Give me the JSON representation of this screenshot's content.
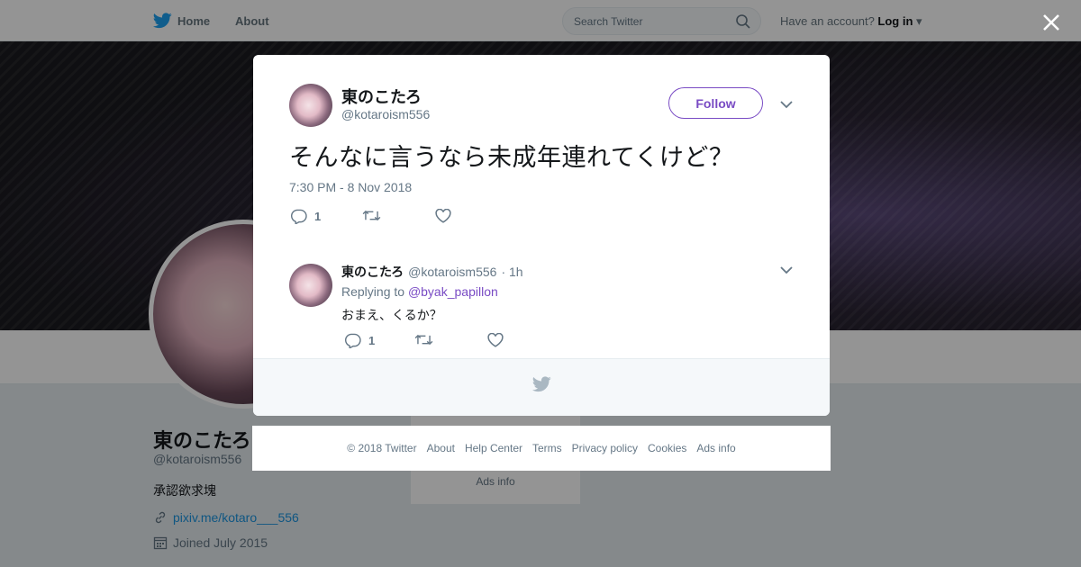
{
  "topnav": {
    "home_label": "Home",
    "about_label": "About",
    "search_placeholder": "Search Twitter",
    "have_account": "Have an account?",
    "login_label": "Log in"
  },
  "profile": {
    "name": "東のこたろ",
    "handle": "@kotaroism556",
    "bio": "承認欲求塊",
    "link": "pixiv.me/kotaro___556",
    "joined": "Joined July 2015",
    "sidecard_ads": "Ads info"
  },
  "tweet": {
    "author_name": "東のこたろ",
    "author_handle": "@kotaroism556",
    "follow_label": "Follow",
    "text": "そんなに言うなら未成年連れてくけど？",
    "timestamp": "7:30 PM - 8 Nov 2018",
    "reply_count": "1"
  },
  "reply": {
    "author_name": "東のこたろ",
    "author_handle": "@kotaroism556",
    "time": "· 1h",
    "replying_prefix": "Replying to",
    "replying_to": "@byak_papillon",
    "text": "おまえ、くるか？",
    "reply_count": "1"
  },
  "footer": {
    "copyright": "© 2018 Twitter",
    "about": "About",
    "help": "Help Center",
    "terms": "Terms",
    "privacy": "Privacy policy",
    "cookies": "Cookies",
    "ads": "Ads info"
  },
  "colors": {
    "accent": "#794bc4",
    "link": "#1b95e0",
    "bird": "#1da1f2",
    "muted": "#657786"
  },
  "icons": [
    "twitter-bird-icon",
    "search-icon",
    "close-icon",
    "reply-icon",
    "retweet-icon",
    "like-icon",
    "chevron-down-icon",
    "link-icon",
    "calendar-icon"
  ]
}
